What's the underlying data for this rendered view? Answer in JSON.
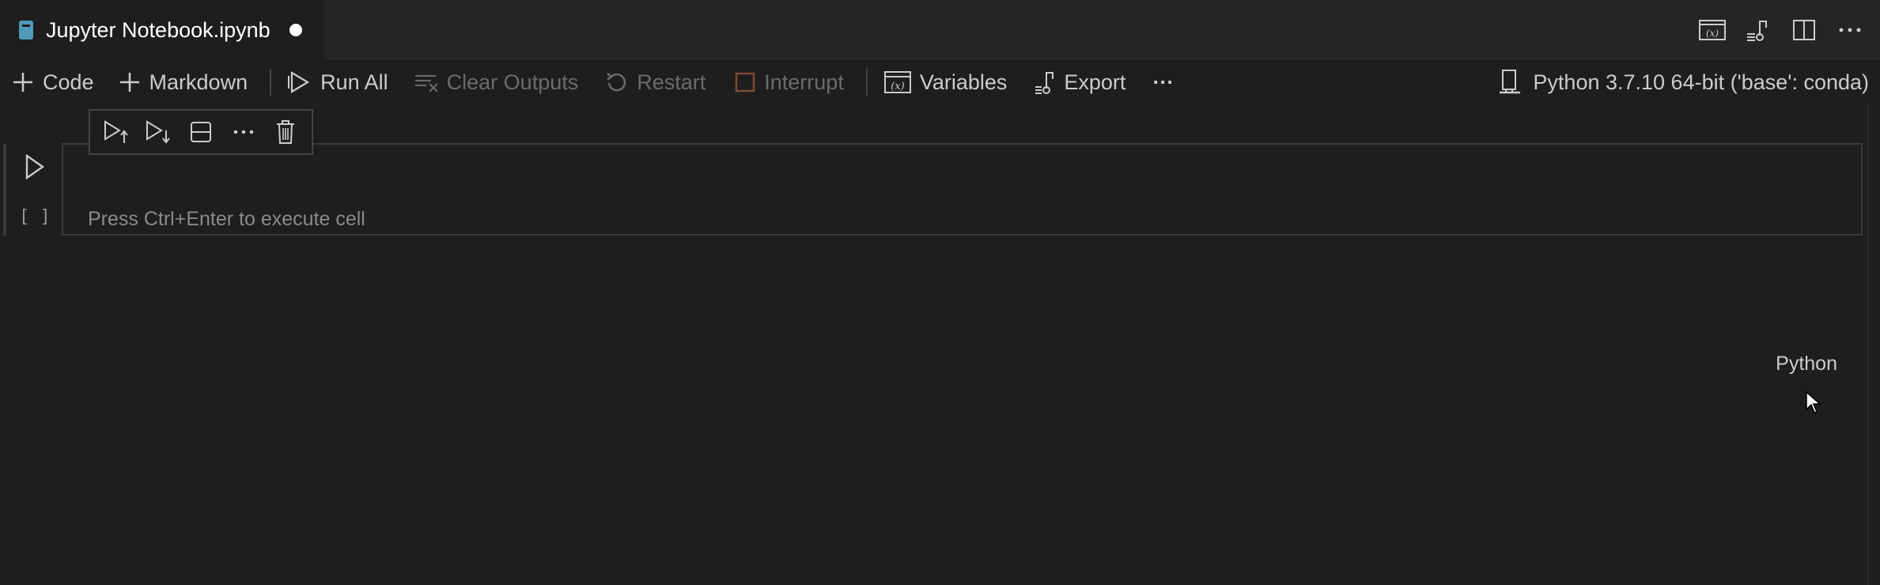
{
  "tab": {
    "title": "Jupyter Notebook.ipynb"
  },
  "tab_actions": [
    {
      "icon": "variables-icon"
    },
    {
      "icon": "outline-icon"
    },
    {
      "icon": "split-editor-icon"
    },
    {
      "icon": "more-actions-icon"
    }
  ],
  "toolbar": {
    "code_label": "Code",
    "markdown_label": "Markdown",
    "run_all_label": "Run All",
    "clear_outputs_label": "Clear Outputs",
    "restart_label": "Restart",
    "interrupt_label": "Interrupt",
    "variables_label": "Variables",
    "export_label": "Export",
    "more_label": "···"
  },
  "kernel": {
    "label": "Python 3.7.10 64-bit ('base': conda)"
  },
  "cell": {
    "exec_count": "[ ]",
    "placeholder": "Press Ctrl+Enter to execute cell",
    "language": "Python"
  },
  "colors": {
    "background": "#1e1e1e",
    "tabbar": "#252526",
    "text": "#cccccc",
    "disabled": "#6b6b6b",
    "notebook_icon": "#519aba",
    "interrupt_icon": "#7a4a38"
  }
}
